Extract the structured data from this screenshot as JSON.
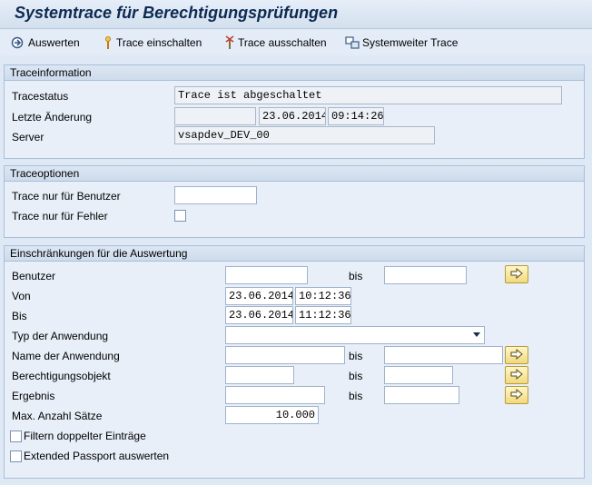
{
  "title": "Systemtrace für Berechtigungsprüfungen",
  "toolbar": {
    "evaluate": "Auswerten",
    "trace_on": "Trace einschalten",
    "trace_off": "Trace ausschalten",
    "system_trace": "Systemweiter Trace"
  },
  "trace_info": {
    "header": "Traceinformation",
    "status_label": "Tracestatus",
    "status_value": "Trace ist abgeschaltet",
    "last_change_label": "Letzte Änderung",
    "last_change_user": "",
    "last_change_date": "23.06.2014",
    "last_change_time": "09:14:26",
    "server_label": "Server",
    "server_value": "vsapdev_DEV_00"
  },
  "trace_options": {
    "header": "Traceoptionen",
    "user_label": "Trace nur für Benutzer",
    "user_value": "",
    "errors_label": "Trace nur für Fehler",
    "errors_checked": false
  },
  "restrictions": {
    "header": "Einschränkungen für die Auswertung",
    "bis_label": "bis",
    "user_label": "Benutzer",
    "from_label": "Von",
    "from_date": "23.06.2014",
    "from_time": "10:12:36",
    "to_label": "Bis",
    "to_date": "23.06.2014",
    "to_time": "11:12:36",
    "app_type_label": "Typ der Anwendung",
    "app_type_value": "",
    "app_name_label": "Name der Anwendung",
    "auth_object_label": "Berechtigungsobjekt",
    "result_label": "Ergebnis",
    "max_records_label": "Max. Anzahl Sätze",
    "max_records_value": "10.000",
    "filter_dup_label": "Filtern doppelter Einträge",
    "passport_label": "Extended Passport auswerten"
  },
  "colors": {
    "background": "#dfe9f5",
    "title": "#0d2a52",
    "arrow_button": "#f1d97e"
  }
}
